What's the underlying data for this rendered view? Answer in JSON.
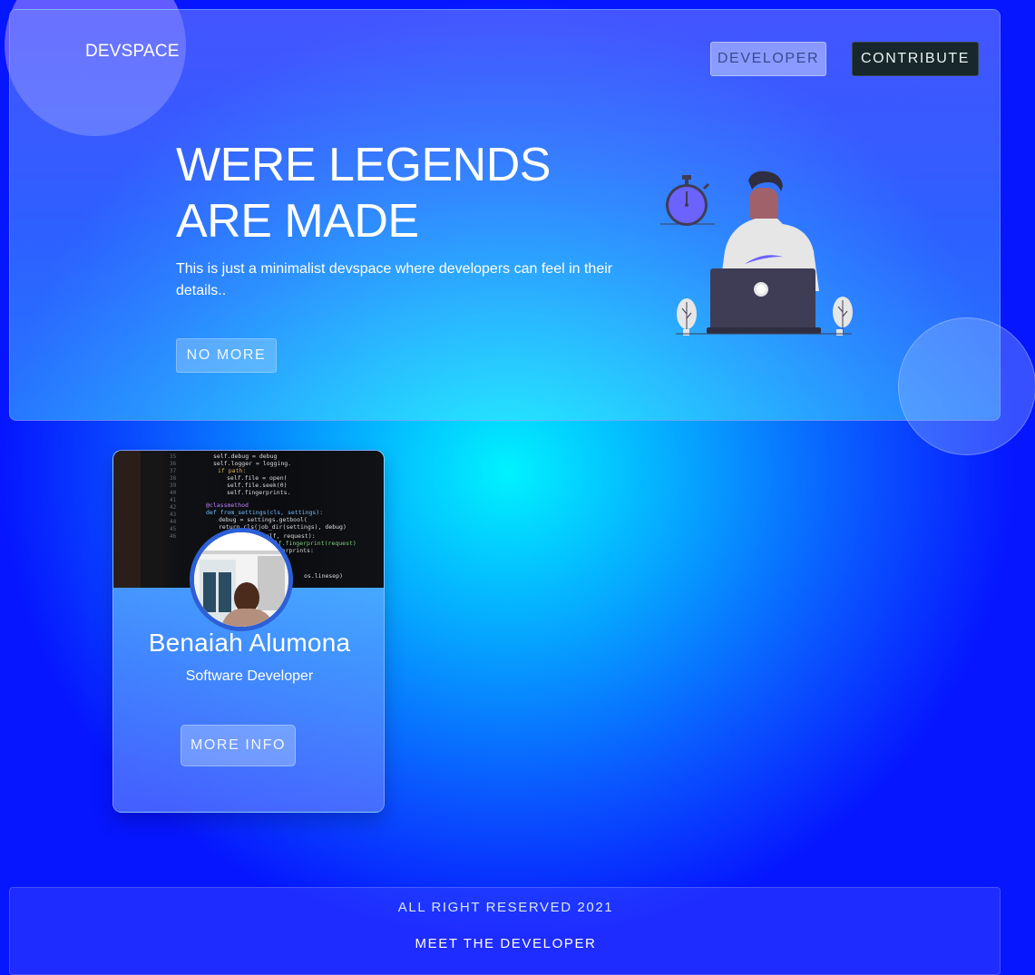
{
  "header": {
    "brand": "DEVSPACE",
    "nav": {
      "developer_label": "DEVELOPER",
      "contribute_label": "CONTRIBUTE"
    }
  },
  "hero": {
    "title": "WERE LEGENDS ARE MADE",
    "subtitle": "This is just a minimalist devspace where developers can feel in their details..",
    "cta_label": "NO MORE",
    "illustration_icon": "developer-at-laptop-illustration"
  },
  "profile_card": {
    "name": "Benaiah Alumona",
    "role": "Software Developer",
    "cta_label": "MORE INFO",
    "banner_image": "code-screen-photo",
    "avatar_image": "profile-photo"
  },
  "footer": {
    "copyright": "ALL RIGHT RESERVED 2021",
    "link_label": "MEET THE DEVELOPER"
  },
  "colors": {
    "background_center": "#00f2ff",
    "background_edge": "#0616ff",
    "contribute_button": "#17272b",
    "avatar_ring": "#2d5fd6",
    "illustration_accent": "#6c63ff"
  }
}
